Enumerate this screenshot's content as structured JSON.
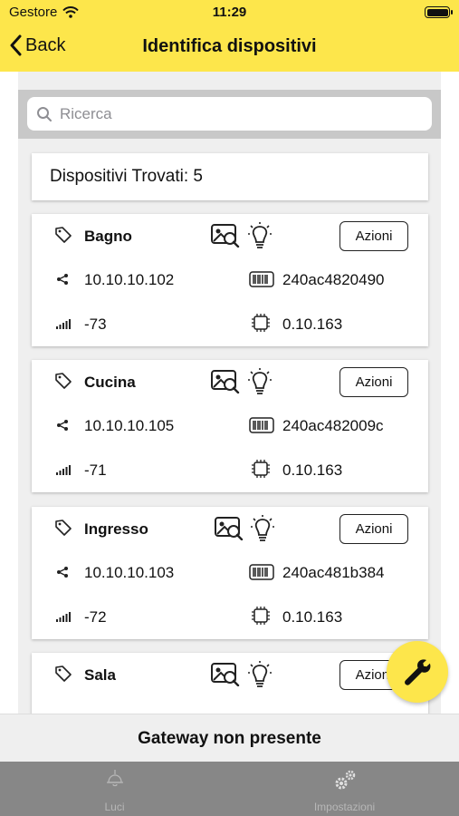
{
  "status_bar": {
    "carrier": "Gestore",
    "time": "11:29"
  },
  "nav": {
    "back_label": "Back",
    "title": "Identifica dispositivi"
  },
  "search": {
    "placeholder": "Ricerca",
    "value": ""
  },
  "devices_found_label": "Dispositivi Trovati: 5",
  "devices": [
    {
      "name": "Bagno",
      "ip": "10.10.10.102",
      "mac": "240ac4820490",
      "signal": "-73",
      "firmware": "0.10.163",
      "actions_label": "Azioni"
    },
    {
      "name": "Cucina",
      "ip": "10.10.10.105",
      "mac": "240ac482009c",
      "signal": "-71",
      "firmware": "0.10.163",
      "actions_label": "Azioni"
    },
    {
      "name": "Ingresso",
      "ip": "10.10.10.103",
      "mac": "240ac481b384",
      "signal": "-72",
      "firmware": "0.10.163",
      "actions_label": "Azioni"
    },
    {
      "name": "Sala",
      "actions_label": "Azioni"
    }
  ],
  "fab": {
    "icon": "wrench-icon"
  },
  "gateway_status": "Gateway non presente",
  "tabs": [
    {
      "label": "Luci",
      "icon": "ceiling-lamp-icon"
    },
    {
      "label": "Impostazioni",
      "icon": "gears-icon"
    }
  ],
  "colors": {
    "accent": "#fde64b",
    "tabbar": "#878787",
    "list_background": "#efefef"
  }
}
